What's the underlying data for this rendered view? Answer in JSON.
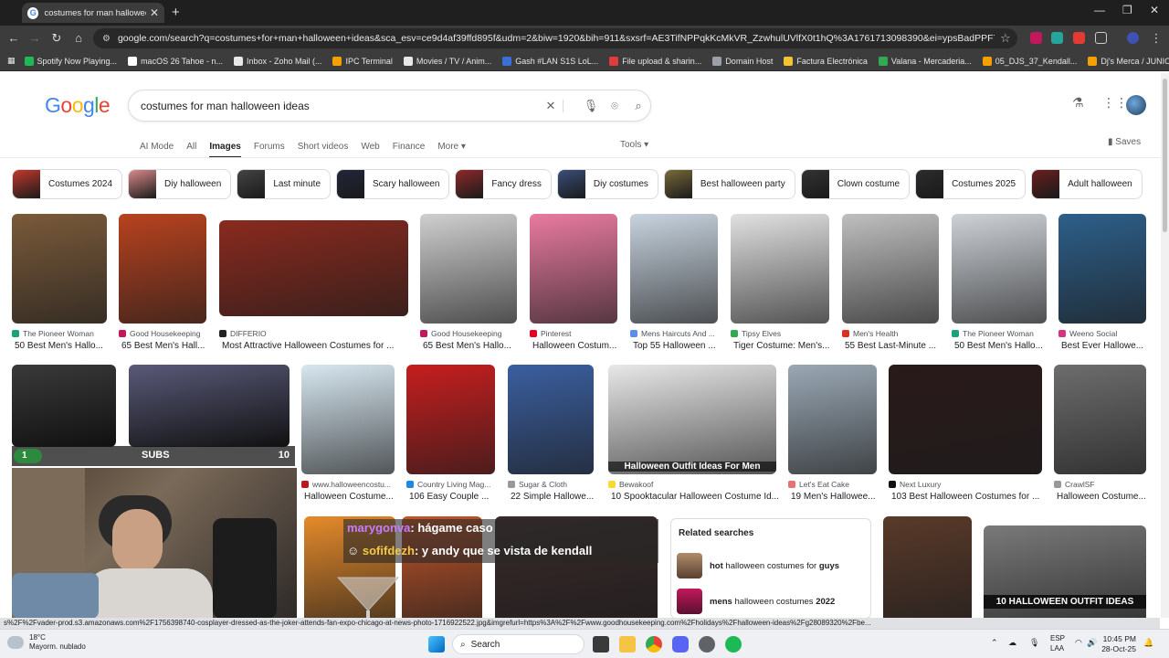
{
  "browser": {
    "tab_title": "costumes for man halloween id",
    "tab_close": "✕",
    "new_tab": "+",
    "url": "google.com/search?q=costumes+for+man+halloween+ideas&sca_esv=ce9d4af39ffd895f&udm=2&biw=1920&bih=911&sxsrf=AE3TifNPPqkKcMkVR_ZzwhulUVlfX0t1hQ%3A1761713098390&ei=ypsBadPPF7LJwbkPkPqlgAw&ved=...",
    "bookmarks": [
      {
        "label": "Spotify Now Playing...",
        "color": "#1db954"
      },
      {
        "label": "macOS 26 Tahoe - n...",
        "color": "#ffffff"
      },
      {
        "label": "Inbox - Zoho Mail (...",
        "color": "#e8e8e8"
      },
      {
        "label": "IPC Terminal",
        "color": "#f4a100"
      },
      {
        "label": "Movies / TV / Anim...",
        "color": "#e8e8e8"
      },
      {
        "label": "Gash #LAN S1S LoL...",
        "color": "#3b6fd8"
      },
      {
        "label": "File upload & sharin...",
        "color": "#e23b3b"
      },
      {
        "label": "Domain Host",
        "color": "#9aa0a6"
      },
      {
        "label": "Factura Electrónica",
        "color": "#f1c232"
      },
      {
        "label": "Valana - Mercaderia...",
        "color": "#34a853"
      },
      {
        "label": "05_DJS_37_Kendall...",
        "color": "#f4a100"
      },
      {
        "label": "Dj's Merca / JUNIO...",
        "color": "#f4a100"
      }
    ]
  },
  "google": {
    "logo": [
      "G",
      "o",
      "o",
      "g",
      "l",
      "e"
    ],
    "logo_colors": [
      "#4285f4",
      "#ea4335",
      "#fbbc05",
      "#4285f4",
      "#34a853",
      "#ea4335"
    ],
    "query": "costumes for man halloween ideas",
    "tabs": [
      "AI Mode",
      "All",
      "Images",
      "Forums",
      "Short videos",
      "Web",
      "Finance",
      "More ▾"
    ],
    "tools": "Tools ▾",
    "saves": "Saves",
    "chips": [
      {
        "label": "Costumes 2024",
        "color": "#c0392b"
      },
      {
        "label": "Diy halloween",
        "color": "#d98a8a"
      },
      {
        "label": "Last minute",
        "color": "#444"
      },
      {
        "label": "Scary halloween",
        "color": "#22263a"
      },
      {
        "label": "Fancy dress",
        "color": "#8e2a2a"
      },
      {
        "label": "Diy costumes",
        "color": "#3a4f7a"
      },
      {
        "label": "Best halloween party",
        "color": "#7a6a3a"
      },
      {
        "label": "Clown costume",
        "color": "#333"
      },
      {
        "label": "Costumes 2025",
        "color": "#2c2c2c"
      },
      {
        "label": "Adult halloween",
        "color": "#6a1f1f"
      },
      {
        "label": "",
        "color": "#b33"
      }
    ],
    "row1": [
      {
        "src": "The Pioneer Woman",
        "title": "50 Best Men's Hallo...",
        "dot": "#1aa37a"
      },
      {
        "src": "Good Housekeeping",
        "title": "65 Best Men's Hall...",
        "dot": "#c2185b"
      },
      {
        "src": "DIFFERIO",
        "title": "Most Attractive Halloween Costumes for ...",
        "dot": "#222"
      },
      {
        "src": "Good Housekeeping",
        "title": "65 Best Men's Hallo...",
        "dot": "#c2185b"
      },
      {
        "src": "Pinterest",
        "title": "Halloween Costum...",
        "dot": "#e60023"
      },
      {
        "src": "Mens Haircuts And ...",
        "title": "Top 55 Halloween ...",
        "dot": "#5b8def"
      },
      {
        "src": "Tipsy Elves",
        "title": "Tiger Costume: Men's...",
        "dot": "#34a853"
      },
      {
        "src": "Men's Health",
        "title": "55 Best Last-Minute ...",
        "dot": "#d93025"
      },
      {
        "src": "The Pioneer Woman",
        "title": "50 Best Men's Hallo...",
        "dot": "#1aa37a"
      },
      {
        "src": "Weeno Social",
        "title": "Best Ever Hallowe...",
        "dot": "#d63384"
      }
    ],
    "row2": [
      {
        "src": "www.halloweencostu...",
        "title": "Halloween Costume...",
        "dot": "#b71c1c"
      },
      {
        "src": "Country Living Mag...",
        "title": "106 Easy Couple ...",
        "dot": "#1e88e5"
      },
      {
        "src": "Sugar & Cloth",
        "title": "22 Simple Hallowe...",
        "dot": "#999"
      },
      {
        "src": "Bewakoof",
        "title": "10 Spooktacular Halloween Costume Id...",
        "dot": "#fdd835"
      },
      {
        "src": "Let's Eat Cake",
        "title": "19 Men's Hallowee...",
        "dot": "#e57373"
      },
      {
        "src": "Next Luxury",
        "title": "103 Best Halloween Costumes for ...",
        "dot": "#111"
      },
      {
        "src": "CrawlSF",
        "title": "Halloween Costume...",
        "dot": "#999"
      }
    ],
    "overlay_text": "Halloween Outfit Ideas For Men",
    "overlay_text2": "10 HALLOWEEN OUTFIT IDEAS",
    "related": {
      "heading": "Related searches",
      "items": [
        {
          "bold": "hot",
          "rest": " halloween costumes for ",
          "bold2": "guys"
        },
        {
          "bold": "mens",
          "rest": " halloween costumes ",
          "bold2": "2022"
        }
      ]
    }
  },
  "stream": {
    "subs_count": "1",
    "subs_label": "SUBS",
    "subs_goal": "10",
    "subs_progress": 0.1,
    "chat": [
      {
        "user": "marygonva",
        "msg": ": hágame caso",
        "color": "#c77dff"
      },
      {
        "user": "sofifdezh",
        "msg": ": y andy que se vista de kendall",
        "color": "#f6c945"
      }
    ]
  },
  "status_url": "s%2F%2Fvader-prod.s3.amazonaws.com%2F1756398740-cosplayer-dressed-as-the-joker-attends-fan-expo-chicago-at-news-photo-1716922522.jpg&imgrefurl=https%3A%2F%2Fwww.goodhousekeeping.com%2Fholidays%2Fhalloween-ideas%2Fg28089320%2Fbe...",
  "taskbar": {
    "temp": "18°C",
    "weather": "Mayorm. nublado",
    "search": "Search",
    "lang": "ESP",
    "layout": "LAA",
    "time": "10:45 PM",
    "date": "28-Oct-25"
  }
}
